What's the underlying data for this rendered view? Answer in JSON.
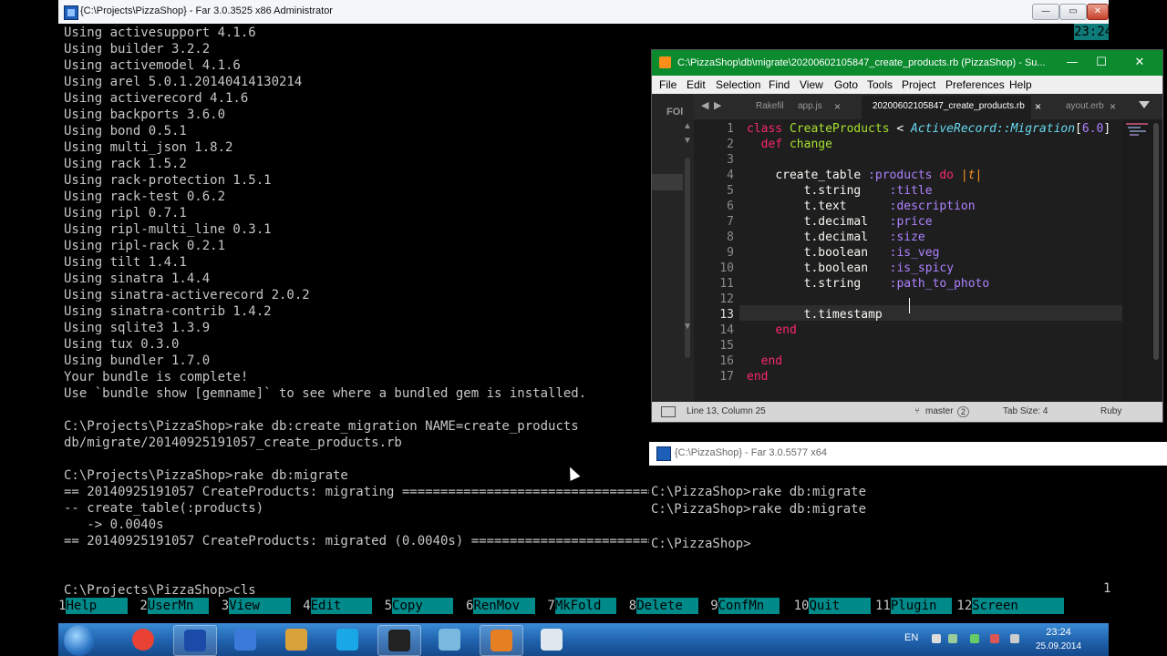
{
  "far_main": {
    "title": "{C:\\Projects\\PizzaShop} - Far 3.0.3525 x86 Administrator",
    "controls": {
      "minimize": "—",
      "maximize": "▭",
      "close": "✕"
    },
    "clock": "23:24",
    "lines": [
      "Using activesupport 4.1.6",
      "Using builder 3.2.2",
      "Using activemodel 4.1.6",
      "Using arel 5.0.1.20140414130214",
      "Using activerecord 4.1.6",
      "Using backports 3.6.0",
      "Using bond 0.5.1",
      "Using multi_json 1.8.2",
      "Using rack 1.5.2",
      "Using rack-protection 1.5.1",
      "Using rack-test 0.6.2",
      "Using ripl 0.7.1",
      "Using ripl-multi_line 0.3.1",
      "Using ripl-rack 0.2.1",
      "Using tilt 1.4.1",
      "Using sinatra 1.4.4",
      "Using sinatra-activerecord 2.0.2",
      "Using sinatra-contrib 1.4.2",
      "Using sqlite3 1.3.9",
      "Using tux 0.3.0",
      "Using bundler 1.7.0",
      "Your bundle is complete!",
      "Use `bundle show [gemname]` to see where a bundled gem is installed.",
      "",
      "C:\\Projects\\PizzaShop>rake db:create_migration NAME=create_products",
      "db/migrate/20140925191057_create_products.rb",
      "",
      "C:\\Projects\\PizzaShop>rake db:migrate",
      "== 20140925191057 CreateProducts: migrating ===================================",
      "-- create_table(:products)",
      "   -> 0.0040s",
      "== 20140925191057 CreateProducts: migrated (0.0040s) ==========================",
      "",
      "",
      "C:\\Projects\\PizzaShop>cls"
    ],
    "right_digit": "1",
    "keybar": [
      {
        "num": "1",
        "label": "Help    "
      },
      {
        "num": "2",
        "label": "UserMn  "
      },
      {
        "num": "3",
        "label": "View    "
      },
      {
        "num": "4",
        "label": "Edit    "
      },
      {
        "num": "5",
        "label": "Copy    "
      },
      {
        "num": "6",
        "label": "RenMov  "
      },
      {
        "num": "7",
        "label": "MkFold  "
      },
      {
        "num": "8",
        "label": "Delete  "
      },
      {
        "num": "9",
        "label": "ConfMn  "
      },
      {
        "num": "10",
        "label": "Quit    "
      },
      {
        "num": "11",
        "label": "Plugin  "
      },
      {
        "num": "12",
        "label": "Screen      "
      }
    ]
  },
  "sublime": {
    "title": "C:\\PizzaShop\\db\\migrate\\20200602105847_create_products.rb (PizzaShop) - Su...",
    "controls": {
      "minimize": "—",
      "maximize": "☐",
      "close": "✕"
    },
    "menu": [
      "File",
      "Edit",
      "Selection",
      "Find",
      "View",
      "Goto",
      "Tools",
      "Project",
      "Preferences",
      "Help"
    ],
    "sidebar_label": "FOl",
    "tabs": [
      {
        "label": "Rakefil",
        "close": ""
      },
      {
        "label": "app.js",
        "close": "×"
      },
      {
        "label": "20200602105847_create_products.rb",
        "close": "×"
      },
      {
        "label": "ayout.erb",
        "close": "×"
      }
    ],
    "line_numbers": [
      "1",
      "2",
      "3",
      "4",
      "5",
      "6",
      "7",
      "8",
      "9",
      "10",
      "11",
      "12",
      "13",
      "14",
      "15",
      "16",
      "17"
    ],
    "code": {
      "l1_kw": "class",
      "l1_cls": "CreateProducts",
      "l1_op": " < ",
      "l1_parent": "ActiveRecord::Migration",
      "l1_ver": "6.0",
      "l2_kw": "def",
      "l2_name": "change",
      "l4_fn": "create_table",
      "l4_sym": ":products",
      "l4_kw": "do",
      "l4_pipe": "|t|",
      "fields": [
        {
          "type": "t.string",
          "name": ":title"
        },
        {
          "type": "t.text",
          "name": ":description"
        },
        {
          "type": "t.decimal",
          "name": ":price"
        },
        {
          "type": "t.decimal",
          "name": ":size"
        },
        {
          "type": "t.boolean",
          "name": ":is_veg"
        },
        {
          "type": "t.boolean",
          "name": ":is_spicy"
        },
        {
          "type": "t.string",
          "name": ":path_to_photo"
        }
      ],
      "l13": "t.timestamp",
      "l14": "end",
      "l16": "end",
      "l17": "end"
    },
    "status": {
      "position": "Line 13, Column 25",
      "branch": "master",
      "branch_count": "2",
      "tab_size": "Tab Size: 4",
      "syntax": "Ruby"
    }
  },
  "far_second": {
    "title": "{C:\\PizzaShop} - Far 3.0.5577 x64",
    "lines": [
      "C:\\PizzaShop>rake db:migrate",
      "C:\\PizzaShop>rake db:migrate",
      "",
      "C:\\PizzaShop>"
    ]
  },
  "taskbar": {
    "apps": [
      "chrome-icon",
      "far-manager-icon",
      "settings-icon",
      "paint-icon",
      "skype-icon",
      "console-icon",
      "explorer-icon",
      "sublime-icon",
      "window-icon"
    ],
    "lang": "EN",
    "time": "23:24",
    "date": "25.09.2014"
  }
}
